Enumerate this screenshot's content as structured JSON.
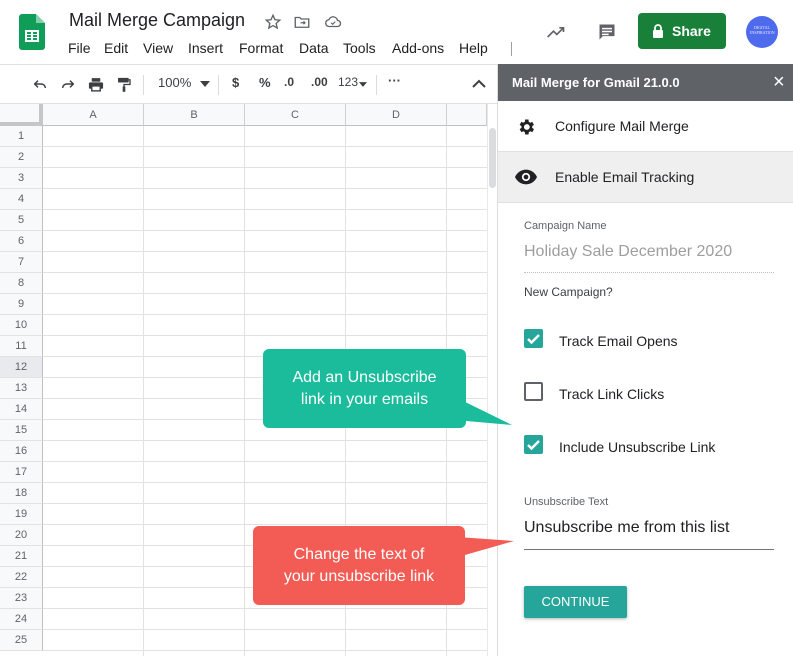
{
  "app": {
    "title": "Mail Merge Campaign",
    "menu": [
      "File",
      "Edit",
      "View",
      "Insert",
      "Format",
      "Data",
      "Tools",
      "Add-ons",
      "Help"
    ],
    "share_label": "Share",
    "avatar_text": "DIGITAL INSPIRATION"
  },
  "toolbar": {
    "zoom": "100%",
    "currency": "$",
    "percent": "%",
    "dec_decrease": ".0",
    "dec_increase": ".00",
    "format": "123",
    "more": "···"
  },
  "sheet": {
    "columns": [
      "A",
      "B",
      "C",
      "D"
    ],
    "rows": [
      "1",
      "2",
      "3",
      "4",
      "5",
      "6",
      "7",
      "8",
      "9",
      "10",
      "11",
      "12",
      "13",
      "14",
      "15",
      "16",
      "17",
      "18",
      "19",
      "20",
      "21",
      "22",
      "23",
      "24",
      "25"
    ]
  },
  "sidebar": {
    "title": "Mail Merge for Gmail 21.0.0",
    "close": "×",
    "configure_label": "Configure Mail Merge",
    "tracking_label": "Enable Email Tracking",
    "campaign_name_label": "Campaign Name",
    "campaign_name_value": "Holiday Sale December 2020",
    "new_campaign": "New Campaign?",
    "track_opens": "Track Email Opens",
    "track_clicks": "Track Link Clicks",
    "include_unsub": "Include Unsubscribe Link",
    "unsub_text_label": "Unsubscribe Text",
    "unsub_text_value": "Unsubscribe me from this list",
    "continue_label": "CONTINUE"
  },
  "callouts": {
    "unsub_link": "Add an Unsubscribe link in your emails",
    "unsub_text": "Change the text of your unsubscribe link"
  },
  "colors": {
    "share": "#188038",
    "teal": "#26a69a",
    "green_callout": "#1abc9c",
    "red_callout": "#f25c54",
    "header": "#5f6368"
  }
}
